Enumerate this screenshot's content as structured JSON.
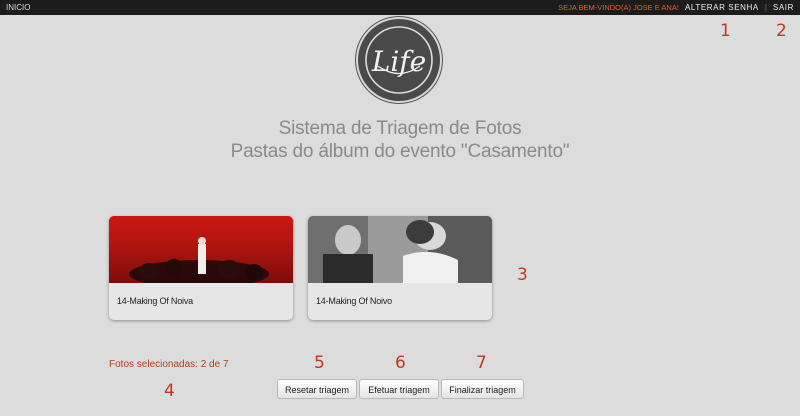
{
  "topbar": {
    "home": "INICIO",
    "welcome": "SEJA BEM-VINDO(A) JOSE E ANA!",
    "change_password": "ALTERAR SENHA",
    "separator": "|",
    "logout": "SAIR"
  },
  "logo": {
    "text": "Life"
  },
  "header": {
    "line1": "Sistema de Triagem de Fotos",
    "line2": "Pastas do álbum do evento \"Casamento\""
  },
  "folders": [
    {
      "label": "14-Making Of Noiva"
    },
    {
      "label": "14-Making Of Noivo"
    }
  ],
  "selection_status": "Fotos selecionadas: 2 de 7",
  "buttons": {
    "reset": "Resetar triagem",
    "run": "Efetuar triagem",
    "finish": "Finalizar triagem"
  },
  "markers": [
    "1",
    "2",
    "3",
    "4",
    "5",
    "6",
    "7"
  ],
  "colors": {
    "accent": "#e0632a",
    "marker": "#c8341f",
    "topbar": "#1c1c1c"
  }
}
